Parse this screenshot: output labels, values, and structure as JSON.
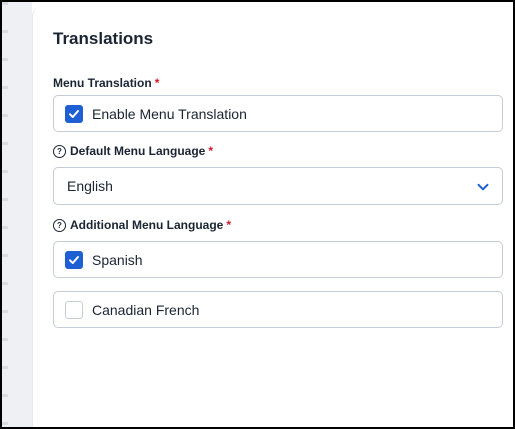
{
  "section": {
    "title": "Translations"
  },
  "menu_translation": {
    "label": "Menu Translation",
    "required_mark": "*",
    "option": {
      "label": "Enable Menu Translation",
      "checked": true
    }
  },
  "default_language": {
    "label": "Default Menu Language",
    "required_mark": "*",
    "help_icon": "question-circle-icon",
    "value": "English",
    "dropdown_icon": "chevron-down-icon"
  },
  "additional_language": {
    "label": "Additional Menu Language",
    "required_mark": "*",
    "help_icon": "question-circle-icon",
    "options": [
      {
        "label": "Spanish",
        "checked": true
      },
      {
        "label": "Canadian French",
        "checked": false
      }
    ]
  },
  "colors": {
    "accent": "#1e5fd3",
    "required": "#d11a2a",
    "text": "#1a2433",
    "border": "#c6ccd6"
  }
}
